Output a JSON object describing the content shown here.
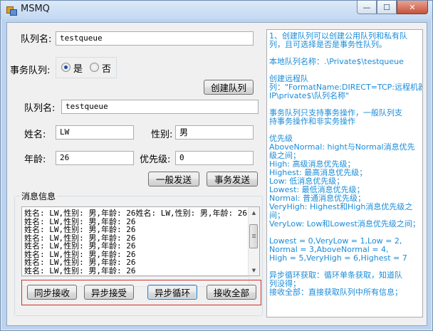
{
  "window": {
    "title": "MSMQ"
  },
  "window_buttons": {
    "minimize": "—",
    "maximize": "☐",
    "close": "✕"
  },
  "form": {
    "queue_name_label": "队列名:",
    "queue_name_value": "testqueue",
    "transaction_label": "事务队列:",
    "radio_yes": "是",
    "radio_no": "否",
    "selected": "是",
    "create_button": "创建队列",
    "queue_name2_label": "队列名:",
    "queue_name2_value": "testqueue",
    "name_label": "姓名:",
    "name_value": "LW",
    "gender_label": "性别:",
    "gender_value": "男",
    "age_label": "年龄:",
    "age_value": "26",
    "priority_label": "优先级:",
    "priority_value": "0",
    "normal_send_button": "一般发送",
    "transaction_send_button": "事务发送"
  },
  "messages": {
    "group_title": "消息信息",
    "lines": [
      "姓名: LW,性别: 男,年龄: 26姓名: LW,性别: 男,年龄: 26",
      "姓名: LW,性别: 男,年龄: 26",
      "姓名: LW,性别: 男,年龄: 26",
      "姓名: LW,性别: 男,年龄: 26",
      "姓名: LW,性别: 男,年龄: 26",
      "姓名: LW,性别: 男,年龄: 26",
      "姓名: LW,性别: 男,年龄: 26",
      "姓名: LW,性别: 男,年龄: 26"
    ],
    "buttons": {
      "sync_receive": "同步接收",
      "async_receive": "异步接受",
      "async_loop": "异步循环",
      "receive_all": "接收全部"
    }
  },
  "info": {
    "lines": [
      "1、创建队列可以创建公用队列和私有队",
      "列，且可选择是否是事务性队列。",
      "",
      "本地队列名称：.\\Private$\\testqueue",
      "",
      "创建远程队",
      "列：\"FormatName:DIRECT=TCP:远程机器",
      "IP\\private$\\队列名称\"",
      "",
      "事务队列只支持事务操作，一般队列支",
      "持事务操作和非实务操作",
      "",
      "优先级",
      "AboveNormal: hight与Normal消息优先",
      "级之间；",
      "High: 高级消息优先级；",
      "Highest: 最高消息优先级；",
      "Low: 低消息优先级；",
      "Lowest: 最低消息优先级；",
      "Normal: 普通消息优先级；",
      "VeryHigh: Highest和High消息优先级之",
      "间；",
      "VeryLow: Low和Lowest消息优先级之间；",
      "",
      "Lowest = 0,VeryLow = 1,Low = 2,",
      "Normal = 3,AboveNormal = 4,",
      "High = 5,VeryHigh = 6,Highest = 7",
      "",
      "异步循环获取：循环单条获取，知道队",
      "列没得；",
      "接收全部：直接获取队列中所有信息；"
    ]
  },
  "colors": {
    "info_text": "#1a8bd8",
    "highlight_border": "#d22d2d",
    "window_frame": "#bcd3ee"
  }
}
